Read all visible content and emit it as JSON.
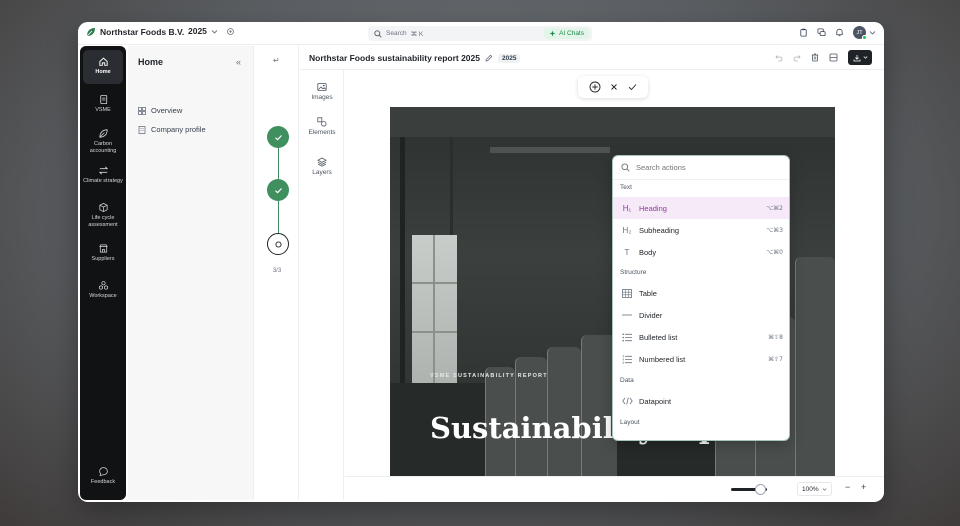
{
  "app": {
    "company": "Northstar Foods B.V.",
    "year": "2025",
    "search_placeholder": "Search",
    "search_shortcut": "⌘ K",
    "ai_label": "AI Chats",
    "avatar_initials": "JT"
  },
  "nav": {
    "items": [
      {
        "label": "Home",
        "icon": "home-icon"
      },
      {
        "label": "VSME",
        "icon": "document-icon"
      },
      {
        "label": "Carbon accounting",
        "icon": "leaf-icon"
      },
      {
        "label": "Climate strategy",
        "icon": "arrows-icon"
      },
      {
        "label": "Life cycle assessment",
        "icon": "box-icon"
      },
      {
        "label": "Suppliers",
        "icon": "store-icon"
      },
      {
        "label": "Workspace",
        "icon": "workspace-icon"
      }
    ],
    "feedback": "Feedback"
  },
  "home_panel": {
    "title": "Home",
    "links": [
      {
        "label": "Overview",
        "icon": "grid-icon"
      },
      {
        "label": "Company profile",
        "icon": "building-icon"
      }
    ]
  },
  "stepper": {
    "count": "3/3"
  },
  "tools": [
    {
      "label": "Images",
      "icon": "image-icon"
    },
    {
      "label": "Elements",
      "icon": "shapes-icon"
    },
    {
      "label": "Layers",
      "icon": "layers-icon"
    }
  ],
  "document": {
    "title": "Northstar Foods sustainability report 2025",
    "year_badge": "2025"
  },
  "cover": {
    "kicker": "VSME SUSTAINABILITY REPORT",
    "title": "Sustainability report"
  },
  "actions_menu": {
    "search_placeholder": "Search actions",
    "sections": [
      {
        "label": "Text",
        "items": [
          {
            "label": "Heading",
            "icon": "H₁",
            "shortcut": "⌥⌘2",
            "highlighted": true
          },
          {
            "label": "Subheading",
            "icon": "H₂",
            "shortcut": "⌥⌘3"
          },
          {
            "label": "Body",
            "icon": "T",
            "shortcut": "⌥⌘0"
          }
        ]
      },
      {
        "label": "Structure",
        "items": [
          {
            "label": "Table",
            "icon": "table-icon",
            "shortcut": ""
          },
          {
            "label": "Divider",
            "icon": "divider-icon",
            "shortcut": ""
          },
          {
            "label": "Bulleted list",
            "icon": "bullet-list-icon",
            "shortcut": "⌘⇧8"
          },
          {
            "label": "Numbered list",
            "icon": "numbered-list-icon",
            "shortcut": "⌘⇧7"
          }
        ]
      },
      {
        "label": "Data",
        "items": [
          {
            "label": "Datapoint",
            "icon": "code-icon",
            "shortcut": ""
          }
        ]
      },
      {
        "label": "Layout",
        "items": []
      }
    ]
  },
  "zoom": {
    "level": "100%",
    "slider_fraction": 0.75
  },
  "colors": {
    "accent_green": "#3f8f5f",
    "highlight": "#f6e9f8",
    "highlight_text": "#8b3f98"
  }
}
